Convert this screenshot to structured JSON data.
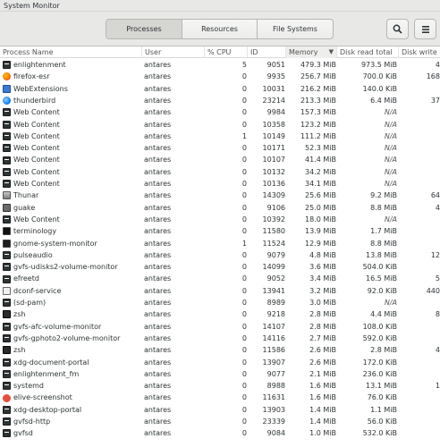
{
  "window": {
    "title": "System Monitor"
  },
  "tabs": [
    {
      "label": "Processes",
      "active": true
    },
    {
      "label": "Resources",
      "active": false
    },
    {
      "label": "File Systems",
      "active": false
    }
  ],
  "toolbar": {
    "search_icon": "search-icon",
    "menu_icon": "hamburger-menu-icon"
  },
  "columns": [
    "Process Name",
    "User",
    "% CPU",
    "ID",
    "Memory",
    "Disk read total",
    "Disk write"
  ],
  "sorted_column": "Memory",
  "rows": [
    {
      "name": "enlightenment",
      "icon": "gen",
      "user": "antares",
      "cpu": "5",
      "id": "9051",
      "memory": "479.3 MiB",
      "read": "973.5 MiB",
      "write": "4"
    },
    {
      "name": "firefox-esr",
      "icon": "ff",
      "user": "antares",
      "cpu": "0",
      "id": "9935",
      "memory": "256.7 MiB",
      "read": "700.0 KiB",
      "write": "168"
    },
    {
      "name": "WebExtensions",
      "icon": "web",
      "user": "antares",
      "cpu": "0",
      "id": "10031",
      "memory": "216.2 MiB",
      "read": "140.0 KiB",
      "write": ""
    },
    {
      "name": "thunderbird",
      "icon": "tb",
      "user": "antares",
      "cpu": "0",
      "id": "23214",
      "memory": "213.3 MiB",
      "read": "6.4 MiB",
      "write": "37"
    },
    {
      "name": "Web Content",
      "icon": "gen",
      "user": "antares",
      "cpu": "0",
      "id": "9984",
      "memory": "157.3 MiB",
      "read": "N/A",
      "write": ""
    },
    {
      "name": "Web Content",
      "icon": "gen",
      "user": "antares",
      "cpu": "0",
      "id": "10358",
      "memory": "123.2 MiB",
      "read": "N/A",
      "write": ""
    },
    {
      "name": "Web Content",
      "icon": "gen",
      "user": "antares",
      "cpu": "1",
      "id": "10149",
      "memory": "111.2 MiB",
      "read": "N/A",
      "write": ""
    },
    {
      "name": "Web Content",
      "icon": "gen",
      "user": "antares",
      "cpu": "0",
      "id": "10171",
      "memory": "52.3 MiB",
      "read": "N/A",
      "write": ""
    },
    {
      "name": "Web Content",
      "icon": "gen",
      "user": "antares",
      "cpu": "0",
      "id": "10107",
      "memory": "41.4 MiB",
      "read": "N/A",
      "write": ""
    },
    {
      "name": "Web Content",
      "icon": "gen",
      "user": "antares",
      "cpu": "0",
      "id": "10132",
      "memory": "34.2 MiB",
      "read": "N/A",
      "write": ""
    },
    {
      "name": "Web Content",
      "icon": "gen",
      "user": "antares",
      "cpu": "0",
      "id": "10136",
      "memory": "34.1 MiB",
      "read": "N/A",
      "write": ""
    },
    {
      "name": "Thunar",
      "icon": "thunar",
      "user": "antares",
      "cpu": "0",
      "id": "14309",
      "memory": "25.6 MiB",
      "read": "9.2 MiB",
      "write": "64"
    },
    {
      "name": "guake",
      "icon": "guake",
      "user": "antares",
      "cpu": "0",
      "id": "9106",
      "memory": "25.0 MiB",
      "read": "8.8 MiB",
      "write": "4"
    },
    {
      "name": "Web Content",
      "icon": "gen",
      "user": "antares",
      "cpu": "0",
      "id": "10392",
      "memory": "18.0 MiB",
      "read": "N/A",
      "write": ""
    },
    {
      "name": "terminology",
      "icon": "term",
      "user": "antares",
      "cpu": "0",
      "id": "11580",
      "memory": "13.9 MiB",
      "read": "1.7 MiB",
      "write": ""
    },
    {
      "name": "gnome-system-monitor",
      "icon": "gsm",
      "user": "antares",
      "cpu": "1",
      "id": "11524",
      "memory": "12.9 MiB",
      "read": "8.8 MiB",
      "write": ""
    },
    {
      "name": "pulseaudio",
      "icon": "gen",
      "user": "antares",
      "cpu": "0",
      "id": "9079",
      "memory": "4.8 MiB",
      "read": "13.8 MiB",
      "write": "12"
    },
    {
      "name": "gvfs-udisks2-volume-monitor",
      "icon": "gen",
      "user": "antares",
      "cpu": "0",
      "id": "14099",
      "memory": "3.6 MiB",
      "read": "504.0 KiB",
      "write": ""
    },
    {
      "name": "efreetd",
      "icon": "gen",
      "user": "antares",
      "cpu": "0",
      "id": "9052",
      "memory": "3.4 MiB",
      "read": "16.5 MiB",
      "write": "5"
    },
    {
      "name": "dconf-service",
      "icon": "dconf",
      "user": "antares",
      "cpu": "0",
      "id": "13941",
      "memory": "3.2 MiB",
      "read": "92.0 KiB",
      "write": "440"
    },
    {
      "name": "(sd-pam)",
      "icon": "gen",
      "user": "antares",
      "cpu": "0",
      "id": "8989",
      "memory": "3.0 MiB",
      "read": "N/A",
      "write": ""
    },
    {
      "name": "zsh",
      "icon": "zsh",
      "user": "antares",
      "cpu": "0",
      "id": "9218",
      "memory": "2.8 MiB",
      "read": "4.4 MiB",
      "write": "8"
    },
    {
      "name": "gvfs-afc-volume-monitor",
      "icon": "gen",
      "user": "antares",
      "cpu": "0",
      "id": "14107",
      "memory": "2.8 MiB",
      "read": "108.0 KiB",
      "write": ""
    },
    {
      "name": "gvfs-gphoto2-volume-monitor",
      "icon": "gen",
      "user": "antares",
      "cpu": "0",
      "id": "14116",
      "memory": "2.7 MiB",
      "read": "592.0 KiB",
      "write": ""
    },
    {
      "name": "zsh",
      "icon": "zsh",
      "user": "antares",
      "cpu": "0",
      "id": "11586",
      "memory": "2.6 MiB",
      "read": "2.8 MiB",
      "write": "4"
    },
    {
      "name": "xdg-document-portal",
      "icon": "gen",
      "user": "antares",
      "cpu": "0",
      "id": "13907",
      "memory": "2.6 MiB",
      "read": "172.0 KiB",
      "write": ""
    },
    {
      "name": "enlightenment_fm",
      "icon": "gen",
      "user": "antares",
      "cpu": "0",
      "id": "9077",
      "memory": "2.1 MiB",
      "read": "236.0 KiB",
      "write": ""
    },
    {
      "name": "systemd",
      "icon": "gen",
      "user": "antares",
      "cpu": "0",
      "id": "8988",
      "memory": "1.6 MiB",
      "read": "13.1 MiB",
      "write": "1"
    },
    {
      "name": "elive-screenshot",
      "icon": "ss",
      "user": "antares",
      "cpu": "0",
      "id": "11631",
      "memory": "1.6 MiB",
      "read": "76.0 KiB",
      "write": ""
    },
    {
      "name": "xdg-desktop-portal",
      "icon": "gen",
      "user": "antares",
      "cpu": "0",
      "id": "13903",
      "memory": "1.4 MiB",
      "read": "1.1 MiB",
      "write": ""
    },
    {
      "name": "gvfsd-http",
      "icon": "gen",
      "user": "antares",
      "cpu": "0",
      "id": "23339",
      "memory": "1.4 MiB",
      "read": "56.0 KiB",
      "write": ""
    },
    {
      "name": "gvfsd",
      "icon": "gen",
      "user": "antares",
      "cpu": "0",
      "id": "9084",
      "memory": "1.0 MiB",
      "read": "532.0 KiB",
      "write": ""
    }
  ]
}
